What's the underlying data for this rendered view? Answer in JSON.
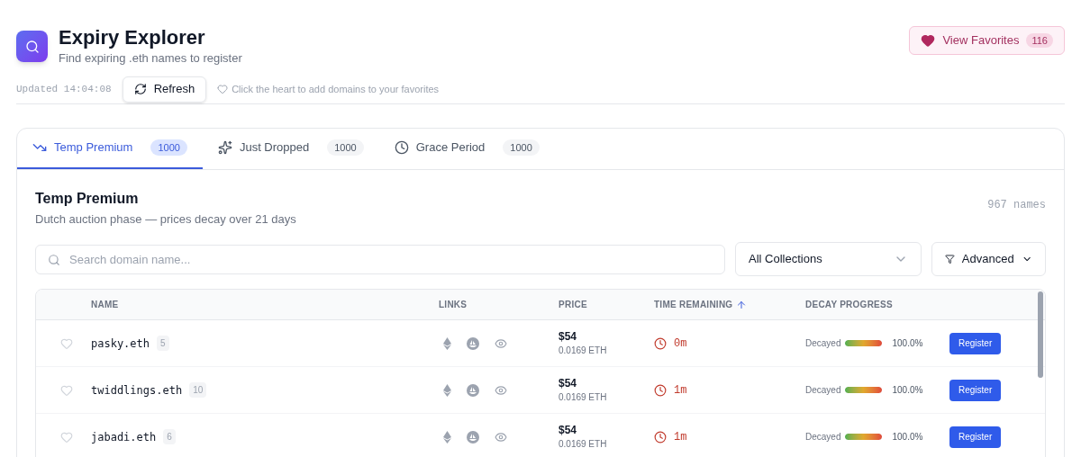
{
  "header": {
    "title": "Expiry Explorer",
    "subtitle": "Find expiring .eth names to register",
    "favorites_button": {
      "label": "View Favorites",
      "count": "116"
    }
  },
  "toolbar": {
    "updated": "Updated 14:04:08",
    "refresh": "Refresh",
    "hint": "Click the heart to add domains to your favorites"
  },
  "tabs": [
    {
      "kind": "trend",
      "label": "Temp Premium",
      "count": "1000",
      "selected": true
    },
    {
      "kind": "sparkle",
      "label": "Just Dropped",
      "count": "1000",
      "selected": false
    },
    {
      "kind": "clock",
      "label": "Grace Period",
      "count": "1000",
      "selected": false
    }
  ],
  "section": {
    "title": "Temp Premium",
    "subtitle": "Dutch auction phase — prices decay over 21 days",
    "count": "967 names"
  },
  "search": {
    "placeholder": "Search domain name..."
  },
  "collection_select": {
    "value": "All Collections"
  },
  "advanced_button": {
    "label": "Advanced"
  },
  "table": {
    "columns": [
      {
        "label": "NAME",
        "sorted": false
      },
      {
        "label": "LINKS",
        "sorted": false
      },
      {
        "label": "PRICE",
        "sorted": false
      },
      {
        "label": "TIME REMAINING",
        "sorted": true
      },
      {
        "label": "DECAY PROGRESS",
        "sorted": false
      }
    ],
    "rows": [
      {
        "favorite": false,
        "name": "pasky.eth",
        "length": "5",
        "price": "$54",
        "price_eth": "0.0169 ETH",
        "time": "0m",
        "decay_label": "Decayed",
        "level": 1.0,
        "percent": "100.0%",
        "action": "Register"
      },
      {
        "favorite": false,
        "name": "twiddlings.eth",
        "length": "10",
        "price": "$54",
        "price_eth": "0.0169 ETH",
        "time": "1m",
        "decay_label": "Decayed",
        "level": 1.0,
        "percent": "100.0%",
        "action": "Register"
      },
      {
        "favorite": false,
        "name": "jabadi.eth",
        "length": "6",
        "price": "$54",
        "price_eth": "0.0169 ETH",
        "time": "1m",
        "decay_label": "Decayed",
        "level": 1.0,
        "percent": "100.0%",
        "action": "Register"
      }
    ]
  }
}
